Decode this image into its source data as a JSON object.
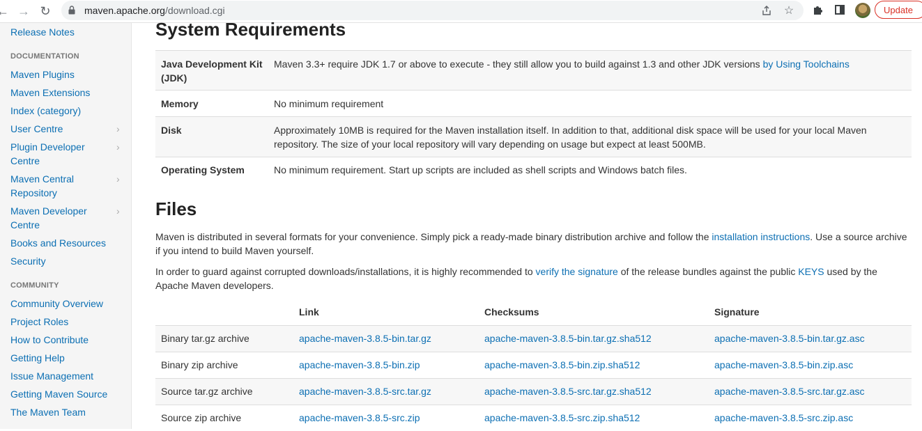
{
  "browser": {
    "url_host": "maven.apache.org",
    "url_path": "/download.cgi",
    "update_label": "Update"
  },
  "sidebar": {
    "top_link": "Release Notes",
    "documentation_header": "DOCUMENTATION",
    "documentation_items": [
      {
        "label": "Maven Plugins"
      },
      {
        "label": "Maven Extensions"
      },
      {
        "label": "Index (category)"
      },
      {
        "label": "User Centre"
      },
      {
        "label": "Plugin Developer Centre"
      },
      {
        "label": "Maven Central Repository"
      },
      {
        "label": "Maven Developer Centre"
      },
      {
        "label": "Books and Resources"
      },
      {
        "label": "Security"
      }
    ],
    "community_header": "COMMUNITY",
    "community_items": [
      {
        "label": "Community Overview"
      },
      {
        "label": "Project Roles"
      },
      {
        "label": "How to Contribute"
      },
      {
        "label": "Getting Help"
      },
      {
        "label": "Issue Management"
      },
      {
        "label": "Getting Maven Source"
      },
      {
        "label": "The Maven Team"
      }
    ]
  },
  "system_requirements": {
    "title": "System Requirements",
    "rows": [
      {
        "key": "Java Development Kit (JDK)",
        "value": "Maven 3.3+ require JDK 1.7 or above to execute - they still allow you to build against 1.3 and other JDK versions ",
        "link": "by Using Toolchains"
      },
      {
        "key": "Memory",
        "value": "No minimum requirement"
      },
      {
        "key": "Disk",
        "value": "Approximately 10MB is required for the Maven installation itself. In addition to that, additional disk space will be used for your local Maven repository. The size of your local repository will vary depending on usage but expect at least 500MB."
      },
      {
        "key": "Operating System",
        "value": "No minimum requirement. Start up scripts are included as shell scripts and Windows batch files."
      }
    ]
  },
  "files": {
    "title": "Files",
    "para1_a": "Maven is distributed in several formats for your convenience. Simply pick a ready-made binary distribution archive and follow the ",
    "para1_link": "installation instructions",
    "para1_b": ". Use a source archive if you intend to build Maven yourself.",
    "para2_a": "In order to guard against corrupted downloads/installations, it is highly recommended to ",
    "para2_link1": "verify the signature",
    "para2_b": " of the release bundles against the public ",
    "para2_link2": "KEYS",
    "para2_c": " used by the Apache Maven developers.",
    "columns": [
      "",
      "Link",
      "Checksums",
      "Signature"
    ],
    "rows": [
      {
        "name": "Binary tar.gz archive",
        "link": "apache-maven-3.8.5-bin.tar.gz",
        "checksum": "apache-maven-3.8.5-bin.tar.gz.sha512",
        "signature": "apache-maven-3.8.5-bin.tar.gz.asc"
      },
      {
        "name": "Binary zip archive",
        "link": "apache-maven-3.8.5-bin.zip",
        "checksum": "apache-maven-3.8.5-bin.zip.sha512",
        "signature": "apache-maven-3.8.5-bin.zip.asc"
      },
      {
        "name": "Source tar.gz archive",
        "link": "apache-maven-3.8.5-src.tar.gz",
        "checksum": "apache-maven-3.8.5-src.tar.gz.sha512",
        "signature": "apache-maven-3.8.5-src.tar.gz.asc"
      },
      {
        "name": "Source zip archive",
        "link": "apache-maven-3.8.5-src.zip",
        "checksum": "apache-maven-3.8.5-src.zip.sha512",
        "signature": "apache-maven-3.8.5-src.zip.asc"
      }
    ]
  }
}
